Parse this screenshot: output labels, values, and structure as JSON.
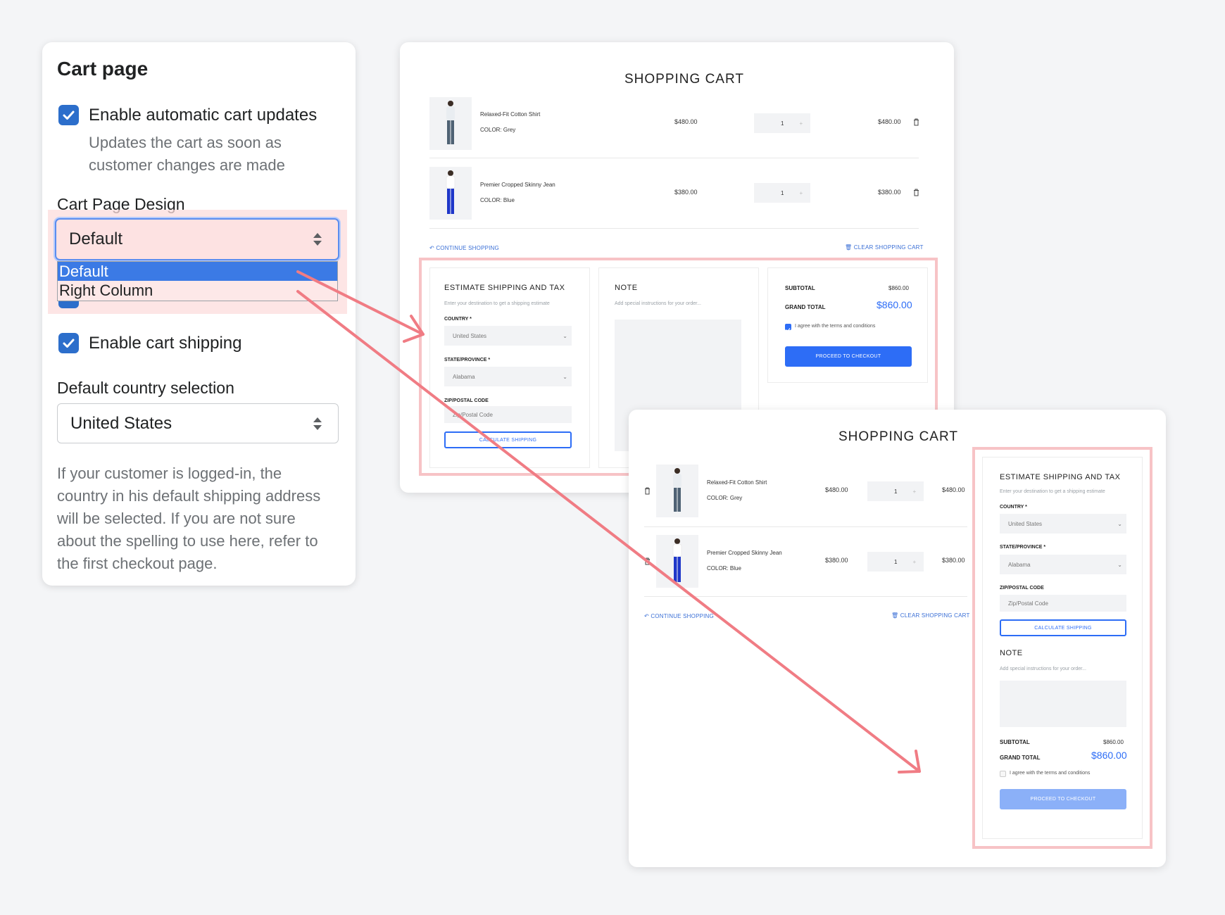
{
  "settings": {
    "title": "Cart page",
    "auto_updates": {
      "label": "Enable automatic cart updates",
      "help_line1": "Updates the cart as soon as",
      "help_line2": "customer changes are made",
      "checked": true
    },
    "design": {
      "label": "Cart Page Design",
      "value": "Default",
      "options": [
        "Default",
        "Right Column"
      ],
      "selected_option": "Default"
    },
    "cart_shipping": {
      "label": "Enable cart shipping",
      "checked": true
    },
    "country": {
      "label": "Default country selection",
      "value": "United States"
    },
    "country_help": [
      "If your customer is logged-in, the",
      "country in his default shipping address",
      "will be selected. If you are not sure",
      "about the spelling to use here, refer to",
      "the first checkout page."
    ]
  },
  "cart": {
    "title": "SHOPPING CART",
    "items": [
      {
        "name": "Relaxed-Fit Cotton Shirt",
        "variant": "COLOR: Grey",
        "price": "$480.00",
        "qty": "1",
        "total": "$480.00"
      },
      {
        "name": "Premier Cropped Skinny Jean",
        "variant": "COLOR: Blue",
        "price": "$380.00",
        "qty": "1",
        "total": "$380.00"
      }
    ],
    "continue": "CONTINUE SHOPPING",
    "clear": "CLEAR SHOPPING CART",
    "estimate": {
      "title": "ESTIMATE SHIPPING AND TAX",
      "hint": "Enter your destination to get a shipping estimate",
      "country_label": "COUNTRY *",
      "country": "United States",
      "state_label": "STATE/PROVINCE *",
      "state": "Alabama",
      "zip_label": "ZIP/POSTAL CODE",
      "zip_placeholder": "Zip/Postal Code",
      "button": "CALCULATE SHIPPING"
    },
    "note": {
      "title": "NOTE",
      "hint": "Add special instructions for your order..."
    },
    "totals": {
      "subtotal_label": "SUBTOTAL",
      "subtotal": "$860.00",
      "grand_label": "GRAND TOTAL",
      "grand": "$860.00",
      "terms": "I agree with the terms and conditions",
      "checkout": "PROCEED TO CHECKOUT"
    }
  },
  "colors": {
    "accent": "#2c6ecb",
    "cart_blue": "#2d6df6",
    "highlight": "#f7c3c6",
    "arrow": "#f07c84"
  }
}
